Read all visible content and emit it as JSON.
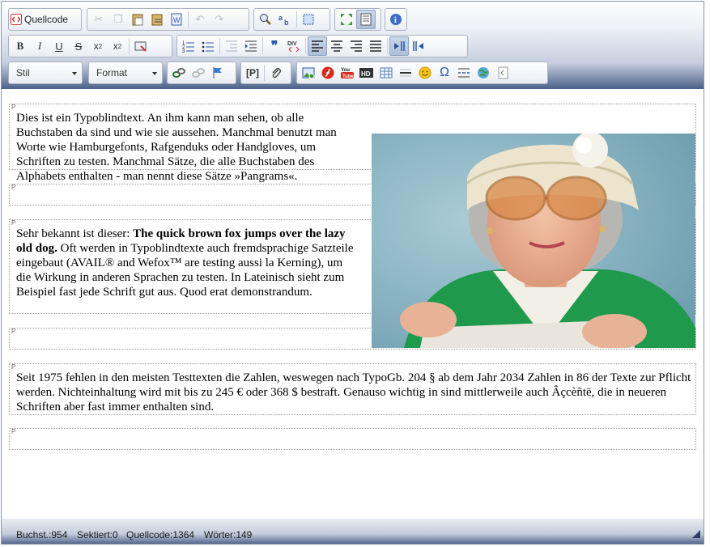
{
  "toolbar": {
    "source_label": "Quellcode",
    "style_label": "Stil",
    "format_label": "Format"
  },
  "content": {
    "para1": "Dies ist ein Typoblindtext. An ihm kann man sehen, ob alle Buchstaben da sind und wie sie aussehen. Manchmal benutzt man Worte wie Hamburgefonts, Rafgenduks oder Handgloves, um Schriften zu testen. Manchmal Sätze, die alle Buchstaben des Alphabets enthalten - man nennt diese Sätze »Pangrams«.",
    "para3_intro": "Sehr bekannt ist dieser: ",
    "para3_bold": "The quick brown fox jumps over the lazy old dog.",
    "para3_rest": " Oft werden in Typoblindtexte auch fremdsprachige Satzteile eingebaut (AVAIL® and Wefox™ are testing aussi la Kerning), um die Wirkung in anderen Sprachen zu testen. In Lateinisch sieht zum Beispiel fast jede Schrift gut aus. Quod erat demonstrandum.",
    "para5": "Seit 1975 fehlen in den meisten Testtexten die Zahlen, weswegen nach TypoGb. 204 § ab dem Jahr 2034 Zahlen in 86 der Texte zur Pflicht werden. Nichteinhaltung wird mit bis zu 245 € oder 368 $ bestraft. Genauso wichtig in sind mittlerweile auch Âçcèñtë, die in neueren Schriften aber fast immer enthalten sind.",
    "para_marker": "P"
  },
  "status": {
    "chars": "Buchst.:954",
    "selected": "Sektiert:0",
    "source": "Quellcode:1364",
    "words": "Wörter:149"
  },
  "colors": {
    "toolbar_bottom": "#4d6189",
    "accent": "#3b5998"
  }
}
